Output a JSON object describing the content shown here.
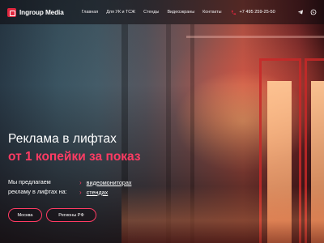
{
  "header": {
    "logo_text": "Ingroup Media",
    "nav": [
      "Главная",
      "Для УК и ТСЖ",
      "Стенды",
      "Видеоэкраны",
      "Контакты"
    ],
    "phone": "+7 495 259-25-50",
    "social": [
      "telegram-icon",
      "whatsapp-icon"
    ]
  },
  "hero": {
    "title": "Реклама в лифтах",
    "subtitle": "от 1 копейки за показ",
    "offer_text_line1": "Мы предлагаем",
    "offer_text_line2": "рекламу в лифтах на:",
    "offer_links": [
      "видеомониторах",
      "стендах"
    ],
    "buttons": [
      "Москва",
      "Регионы РФ"
    ]
  },
  "colors": {
    "accent": "#ff3b63",
    "brand_red": "#e0263e",
    "background": "#140d10"
  }
}
